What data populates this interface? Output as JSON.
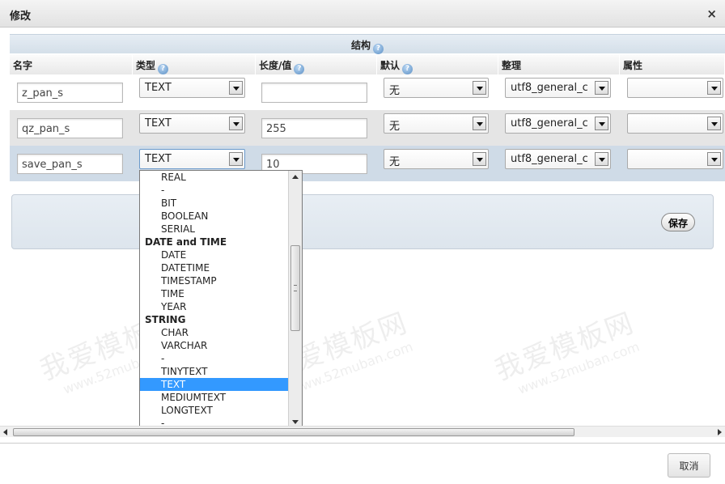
{
  "dialog": {
    "title": "修改",
    "close_glyph": "×"
  },
  "structure": {
    "label": "结构",
    "help_glyph": "?"
  },
  "columns": [
    {
      "label": "名字",
      "help": false
    },
    {
      "label": "类型",
      "help": true
    },
    {
      "label": "长度/值",
      "help": true
    },
    {
      "label": "默认",
      "help": true
    },
    {
      "label": "整理",
      "help": false
    },
    {
      "label": "属性",
      "help": false
    }
  ],
  "rows": [
    {
      "name": "z_pan_s",
      "type": "TEXT",
      "length": "",
      "default": "无",
      "collation": "utf8_general_c",
      "attribute": ""
    },
    {
      "name": "qz_pan_s",
      "type": "TEXT",
      "length": "255",
      "default": "无",
      "collation": "utf8_general_c",
      "attribute": ""
    },
    {
      "name": "save_pan_s",
      "type": "TEXT",
      "length": "10",
      "default": "无",
      "collation": "utf8_general_c",
      "attribute": ""
    }
  ],
  "type_dropdown": {
    "options": [
      {
        "label": "REAL",
        "group": false,
        "selected": false
      },
      {
        "label": "-",
        "group": false,
        "selected": false
      },
      {
        "label": "BIT",
        "group": false,
        "selected": false
      },
      {
        "label": "BOOLEAN",
        "group": false,
        "selected": false
      },
      {
        "label": "SERIAL",
        "group": false,
        "selected": false
      },
      {
        "label": "DATE and TIME",
        "group": true,
        "selected": false
      },
      {
        "label": "DATE",
        "group": false,
        "selected": false
      },
      {
        "label": "DATETIME",
        "group": false,
        "selected": false
      },
      {
        "label": "TIMESTAMP",
        "group": false,
        "selected": false
      },
      {
        "label": "TIME",
        "group": false,
        "selected": false
      },
      {
        "label": "YEAR",
        "group": false,
        "selected": false
      },
      {
        "label": "STRING",
        "group": true,
        "selected": false
      },
      {
        "label": "CHAR",
        "group": false,
        "selected": false
      },
      {
        "label": "VARCHAR",
        "group": false,
        "selected": false
      },
      {
        "label": "-",
        "group": false,
        "selected": false
      },
      {
        "label": "TINYTEXT",
        "group": false,
        "selected": false
      },
      {
        "label": "TEXT",
        "group": false,
        "selected": true
      },
      {
        "label": "MEDIUMTEXT",
        "group": false,
        "selected": false
      },
      {
        "label": "LONGTEXT",
        "group": false,
        "selected": false
      },
      {
        "label": "-",
        "group": false,
        "selected": false
      }
    ],
    "selected_color": "#3399ff"
  },
  "actions": {
    "save_label": "保存",
    "cancel_label": "取消"
  },
  "watermark": {
    "text": "我爱模板网",
    "url": "www.52muban.com"
  }
}
